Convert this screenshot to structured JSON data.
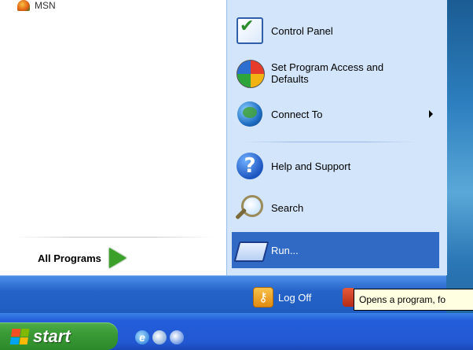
{
  "left_pane": {
    "msn_label": "MSN",
    "all_programs_label": "All Programs"
  },
  "right_pane": {
    "items": [
      {
        "label": "Control Panel",
        "icon": "control-panel-icon"
      },
      {
        "label": "Set Program Access and Defaults",
        "icon": "program-access-icon"
      },
      {
        "label": "Connect To",
        "icon": "connect-to-icon",
        "submenu": true
      },
      {
        "label": "Help and Support",
        "icon": "help-icon"
      },
      {
        "label": "Search",
        "icon": "search-icon"
      },
      {
        "label": "Run...",
        "icon": "run-icon",
        "selected": true
      }
    ]
  },
  "bottom_bar": {
    "logoff_label": "Log Off",
    "tooltip": "Opens a program, fo"
  },
  "taskbar": {
    "start_label": "start"
  },
  "colors": {
    "selection": "#316ac5",
    "right_pane_bg": "#d3e5fa",
    "start_green": "#3a9a36",
    "taskbar_blue": "#245edb"
  }
}
